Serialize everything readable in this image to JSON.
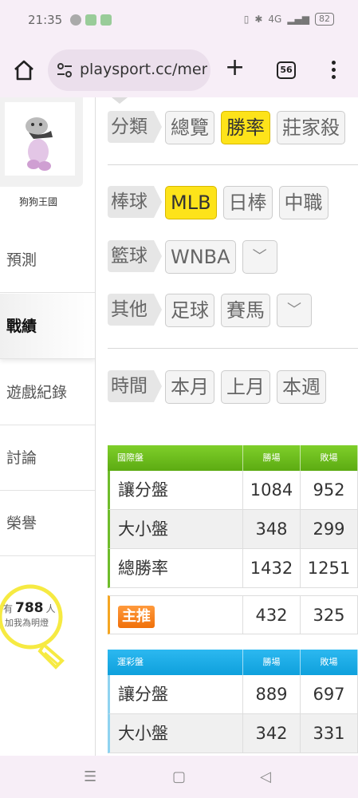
{
  "status": {
    "time": "21:35",
    "battery": "82",
    "signal": "4G"
  },
  "browser": {
    "url": "playsport.cc/men",
    "tab_count": "56"
  },
  "sidebar": {
    "username": "狗狗王國",
    "items": [
      {
        "label": "預測"
      },
      {
        "label": "戰績"
      },
      {
        "label": "遊戲紀錄"
      },
      {
        "label": "討論"
      },
      {
        "label": "榮譽"
      }
    ],
    "bulb": {
      "prefix": "有",
      "count": "788",
      "suffix": "人",
      "caption": "加我為明燈"
    }
  },
  "filters": {
    "category": {
      "label": "分類",
      "options": [
        "總覽",
        "勝率",
        "莊家殺"
      ],
      "selected": "勝率"
    },
    "baseball": {
      "label": "棒球",
      "options": [
        "MLB",
        "日棒",
        "中職"
      ],
      "selected": "MLB"
    },
    "basketball": {
      "label": "籃球",
      "options": [
        "WNBA"
      ]
    },
    "other": {
      "label": "其他",
      "options": [
        "足球",
        "賽馬"
      ]
    },
    "time": {
      "label": "時間",
      "options": [
        "本月",
        "上月",
        "本週"
      ]
    }
  },
  "international_table": {
    "header": {
      "name": "國際盤",
      "win": "勝場",
      "loss": "敗場"
    },
    "rows": [
      {
        "name": "讓分盤",
        "win": "1084",
        "loss": "952"
      },
      {
        "name": "大小盤",
        "win": "348",
        "loss": "299"
      },
      {
        "name": "總勝率",
        "win": "1432",
        "loss": "1251"
      }
    ],
    "featured": {
      "name": "主推",
      "win": "432",
      "loss": "325"
    }
  },
  "lottery_table": {
    "header": {
      "name": "運彩盤",
      "win": "勝場",
      "loss": "敗場"
    },
    "rows": [
      {
        "name": "讓分盤",
        "win": "889",
        "loss": "697"
      },
      {
        "name": "大小盤",
        "win": "342",
        "loss": "331"
      }
    ]
  },
  "colors": {
    "selected_chip": "#fde31a",
    "intl_header": "#6ebc2a",
    "lottery_header": "#1aa9e5",
    "featured_badge": "#f07c16"
  }
}
